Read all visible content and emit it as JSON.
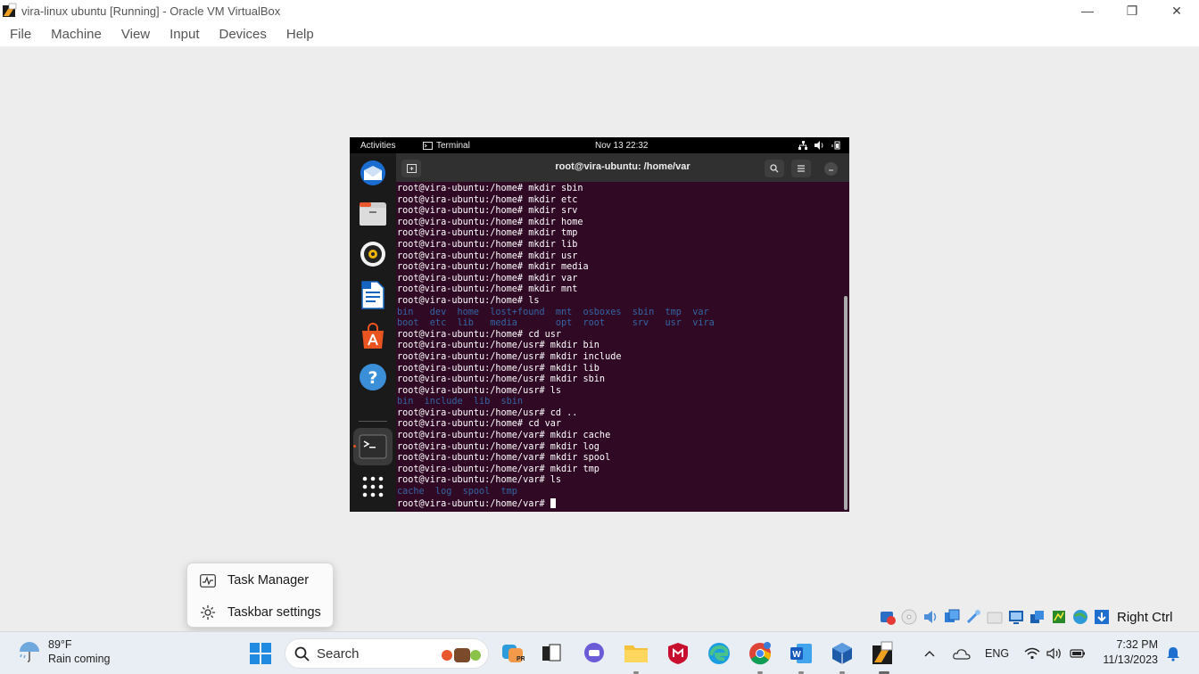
{
  "window": {
    "title": "vira-linux ubuntu [Running] - Oracle VM VirtualBox",
    "controls": {
      "minimize": "—",
      "restore": "❐",
      "close": "✕"
    }
  },
  "menu": [
    "File",
    "Machine",
    "View",
    "Input",
    "Devices",
    "Help"
  ],
  "guest": {
    "topbar": {
      "activities": "Activities",
      "app": "Terminal",
      "datetime": "Nov 13  22:32"
    },
    "dock": [
      "thunderbird-icon",
      "files-icon",
      "rhythmbox-icon",
      "writer-icon",
      "app-center-icon",
      "help-icon",
      "terminal-icon",
      "show-apps-icon"
    ],
    "terminal": {
      "title": "root@vira-ubuntu: /home/var",
      "lines": [
        {
          "t": "root@vira-ubuntu:/home# mkdir sbin",
          "c": "plain"
        },
        {
          "t": "root@vira-ubuntu:/home# mkdir etc",
          "c": "plain"
        },
        {
          "t": "root@vira-ubuntu:/home# mkdir srv",
          "c": "plain"
        },
        {
          "t": "root@vira-ubuntu:/home# mkdir home",
          "c": "plain"
        },
        {
          "t": "root@vira-ubuntu:/home# mkdir tmp",
          "c": "plain"
        },
        {
          "t": "root@vira-ubuntu:/home# mkdir lib",
          "c": "plain"
        },
        {
          "t": "root@vira-ubuntu:/home# mkdir usr",
          "c": "plain"
        },
        {
          "t": "root@vira-ubuntu:/home# mkdir media",
          "c": "plain"
        },
        {
          "t": "root@vira-ubuntu:/home# mkdir var",
          "c": "plain"
        },
        {
          "t": "root@vira-ubuntu:/home# mkdir mnt",
          "c": "plain"
        },
        {
          "t": "root@vira-ubuntu:/home# ls",
          "c": "plain"
        },
        {
          "t": "bin   dev  home  lost+found  mnt  osboxes  sbin  tmp  var",
          "c": "dir"
        },
        {
          "t": "boot  etc  lib   media       opt  root     srv   usr  vira",
          "c": "dir"
        },
        {
          "t": "root@vira-ubuntu:/home# cd usr",
          "c": "plain"
        },
        {
          "t": "root@vira-ubuntu:/home/usr# mkdir bin",
          "c": "plain"
        },
        {
          "t": "root@vira-ubuntu:/home/usr# mkdir include",
          "c": "plain"
        },
        {
          "t": "root@vira-ubuntu:/home/usr# mkdir lib",
          "c": "plain"
        },
        {
          "t": "root@vira-ubuntu:/home/usr# mkdir sbin",
          "c": "plain"
        },
        {
          "t": "root@vira-ubuntu:/home/usr# ls",
          "c": "plain"
        },
        {
          "t": "bin  include  lib  sbin",
          "c": "dir"
        },
        {
          "t": "root@vira-ubuntu:/home/usr# cd ..",
          "c": "plain"
        },
        {
          "t": "root@vira-ubuntu:/home# cd var",
          "c": "plain"
        },
        {
          "t": "root@vira-ubuntu:/home/var# mkdir cache",
          "c": "plain"
        },
        {
          "t": "root@vira-ubuntu:/home/var# mkdir log",
          "c": "plain"
        },
        {
          "t": "root@vira-ubuntu:/home/var# mkdir spool",
          "c": "plain"
        },
        {
          "t": "root@vira-ubuntu:/home/var# mkdir tmp",
          "c": "plain"
        },
        {
          "t": "root@vira-ubuntu:/home/var# ls",
          "c": "plain"
        },
        {
          "t": "cache  log  spool  tmp",
          "c": "dir"
        }
      ],
      "prompt": "root@vira-ubuntu:/home/var# "
    }
  },
  "context_menu": {
    "task_manager": "Task Manager",
    "taskbar_settings": "Taskbar settings"
  },
  "vbox_status": {
    "host_key": "Right Ctrl"
  },
  "taskbar": {
    "weather_temp": "89°F",
    "weather_desc": "Rain coming",
    "search_label": "Search",
    "tray_lang": "ENG",
    "time": "7:32 PM",
    "date": "11/13/2023"
  },
  "colors": {
    "terminal_bg": "#300a24",
    "directory_blue": "#3465a4",
    "taskbar_bg": "#e9eef4",
    "ubuntu_orange": "#e95420"
  }
}
